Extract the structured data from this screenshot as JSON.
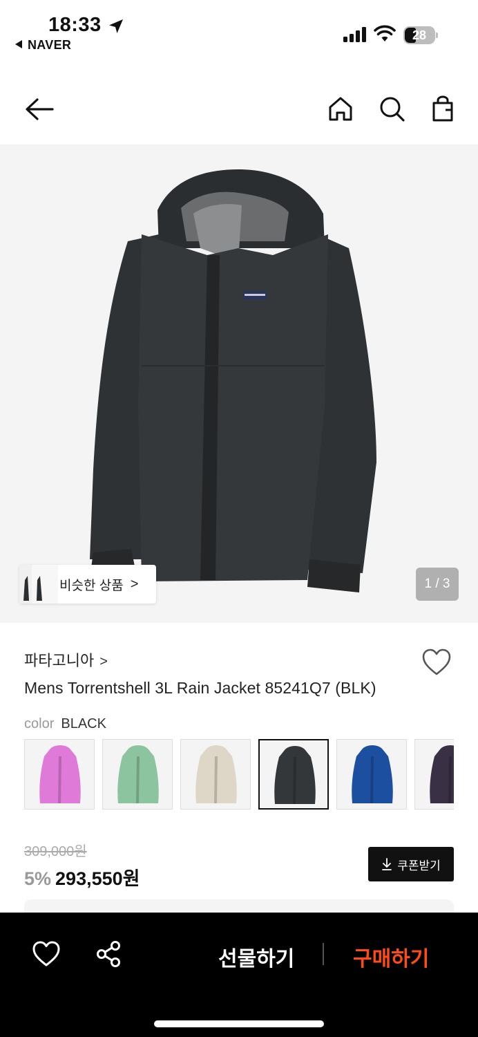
{
  "status_bar": {
    "time": "18:33",
    "back_app": "NAVER",
    "battery": "28"
  },
  "nav": {
    "icons": [
      "arrow-left-icon",
      "home-icon",
      "search-icon",
      "shopping-bag-icon"
    ]
  },
  "hero": {
    "similar_label": "비슷한 상품",
    "similar_chevron": ">",
    "pager": "1 / 3"
  },
  "product": {
    "brand": "파타고니아",
    "brand_chevron": ">",
    "title": "Mens Torrentshell 3L Rain Jacket 85241Q7 (BLK)",
    "color_label": "color",
    "color_value": "BLACK"
  },
  "swatches": [
    {
      "color": "#e07ad8",
      "selected": false
    },
    {
      "color": "#8cc4a0",
      "selected": false
    },
    {
      "color": "#ded7c8",
      "selected": false
    },
    {
      "color": "#34373a",
      "selected": true
    },
    {
      "color": "#1d4fa0",
      "selected": false
    },
    {
      "color": "#3a3045",
      "selected": false
    }
  ],
  "price": {
    "original": "309,000원",
    "discount": "5%",
    "sale": "293,550원"
  },
  "coupon": {
    "icon": "download-icon",
    "label": "쿠폰받기"
  },
  "bottom_bar": {
    "gift_label": "선물하기",
    "buy_label": "구매하기",
    "buy_color": "#ff4b17"
  }
}
